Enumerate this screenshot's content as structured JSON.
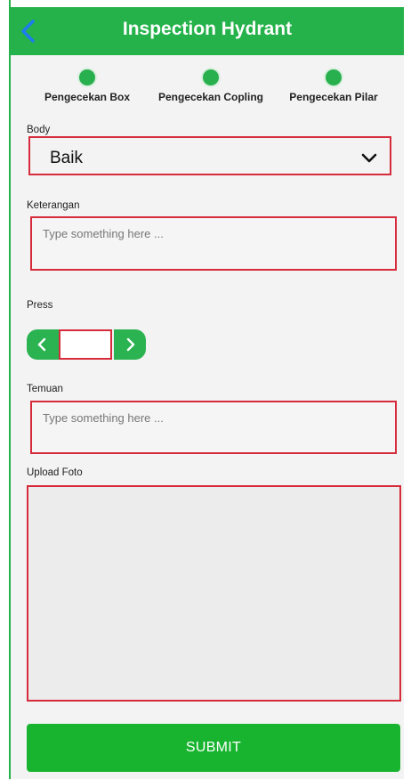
{
  "header": {
    "title": "Inspection Hydrant",
    "back_icon": "chevron-left-icon"
  },
  "steps": [
    {
      "label": "Pengecekan Box"
    },
    {
      "label": "Pengecekan Copling"
    },
    {
      "label": "Pengecekan Pilar"
    }
  ],
  "form": {
    "body": {
      "label": "Body",
      "value": "Baik"
    },
    "keterangan": {
      "label": "Keterangan",
      "placeholder": "Type something here ..."
    },
    "press": {
      "label": "Press",
      "value": ""
    },
    "temuan": {
      "label": "Temuan",
      "placeholder": "Type something here ..."
    },
    "upload": {
      "label": "Upload Foto"
    }
  },
  "submit_label": "SUBMIT",
  "colors": {
    "accent": "#25b24a",
    "highlight": "#d62b3b",
    "submit": "#18b42f"
  }
}
